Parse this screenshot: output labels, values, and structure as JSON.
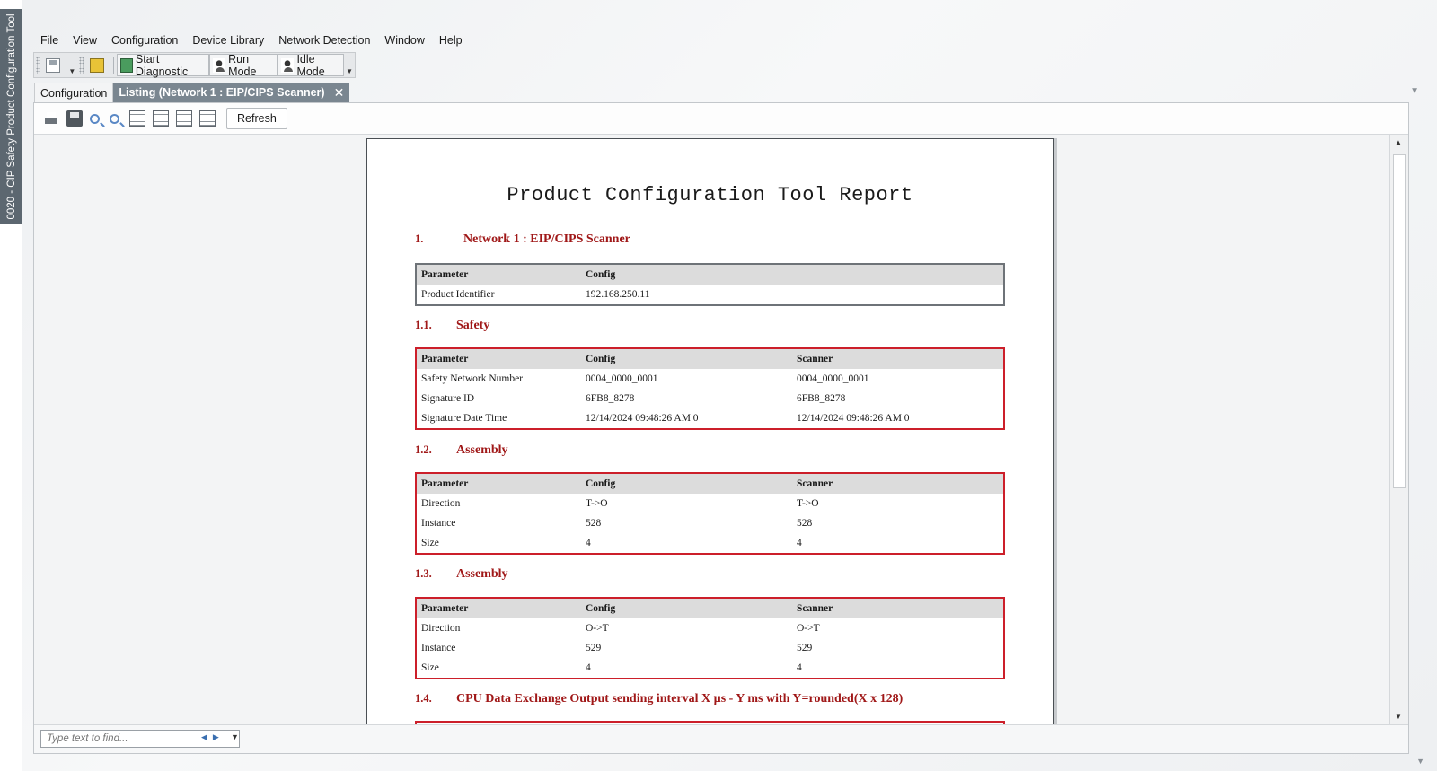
{
  "side_tab": {
    "label": "0020 - CIP Safety Product Configuration Tool"
  },
  "menubar": {
    "items": [
      "File",
      "View",
      "Configuration",
      "Device Library",
      "Network Detection",
      "Window",
      "Help"
    ]
  },
  "toolbar": {
    "start_diagnostic": "Start Diagnostic",
    "run_mode": "Run Mode",
    "idle_mode": "Idle Mode"
  },
  "doc_tabs": {
    "configuration": "Configuration",
    "listing": "Listing (Network 1 : EIP/CIPS Scanner)",
    "close_glyph": "✕"
  },
  "report_toolbar": {
    "refresh": "Refresh"
  },
  "report": {
    "title": "Product Configuration Tool Report",
    "sections": [
      {
        "num": "1.",
        "title": "Network 1 : EIP/CIPS Scanner"
      },
      {
        "num": "1.1.",
        "title": "Safety"
      },
      {
        "num": "1.2.",
        "title": "Assembly"
      },
      {
        "num": "1.3.",
        "title": "Assembly"
      },
      {
        "num": "1.4.",
        "title": "CPU Data Exchange Output sending interval X µs - Y ms with Y=rounded(X x 128)"
      }
    ],
    "table_network": {
      "headers": [
        "Parameter",
        "Config"
      ],
      "rows": [
        [
          "Product Identifier",
          "192.168.250.11"
        ]
      ]
    },
    "table_safety": {
      "headers": [
        "Parameter",
        "Config",
        "Scanner"
      ],
      "rows": [
        [
          "Safety Network Number",
          "0004_0000_0001",
          "0004_0000_0001"
        ],
        [
          "Signature ID",
          "6FB8_8278",
          "6FB8_8278"
        ],
        [
          "Signature Date Time",
          "12/14/2024 09:48:26 AM 0",
          "12/14/2024 09:48:26 AM 0"
        ]
      ]
    },
    "table_assembly_1": {
      "headers": [
        "Parameter",
        "Config",
        "Scanner"
      ],
      "rows": [
        [
          "Direction",
          "T->O",
          "T->O"
        ],
        [
          "Instance",
          "528",
          "528"
        ],
        [
          "Size",
          "4",
          "4"
        ]
      ]
    },
    "table_assembly_2": {
      "headers": [
        "Parameter",
        "Config",
        "Scanner"
      ],
      "rows": [
        [
          "Direction",
          "O->T",
          "O->T"
        ],
        [
          "Instance",
          "529",
          "529"
        ],
        [
          "Size",
          "4",
          "4"
        ]
      ]
    }
  },
  "find": {
    "placeholder": "Type text to find..."
  }
}
